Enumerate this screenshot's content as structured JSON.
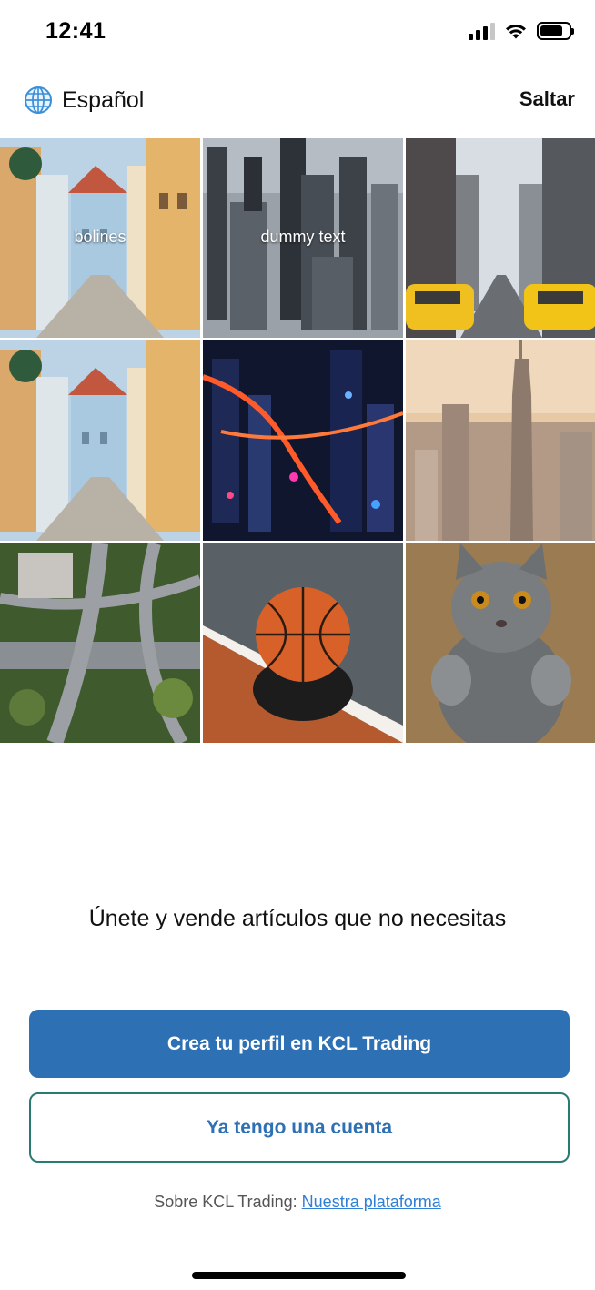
{
  "status_bar": {
    "time": "12:41"
  },
  "header": {
    "language_label": "Español",
    "skip_label": "Saltar"
  },
  "grid": {
    "tiles": [
      {
        "name": "street-houses",
        "caption": "bolines"
      },
      {
        "name": "city-aerial",
        "caption": "dummy text"
      },
      {
        "name": "taxi-street",
        "caption": ""
      },
      {
        "name": "street-houses-2",
        "caption": ""
      },
      {
        "name": "city-night",
        "caption": ""
      },
      {
        "name": "skyline",
        "caption": ""
      },
      {
        "name": "highway-interchange",
        "caption": ""
      },
      {
        "name": "basketball",
        "caption": ""
      },
      {
        "name": "cat",
        "caption": ""
      }
    ]
  },
  "tagline": "Únete y vende  artículos que no necesitas",
  "actions": {
    "primary_label": "Crea tu perfil en KCL Trading",
    "secondary_label": "Ya tengo una cuenta"
  },
  "about": {
    "prefix": "Sobre KCL Trading: ",
    "link_label": "Nuestra plataforma"
  },
  "colors": {
    "primary": "#2e70b4",
    "secondary_border": "#2a7a72",
    "link": "#2f7fd6"
  }
}
